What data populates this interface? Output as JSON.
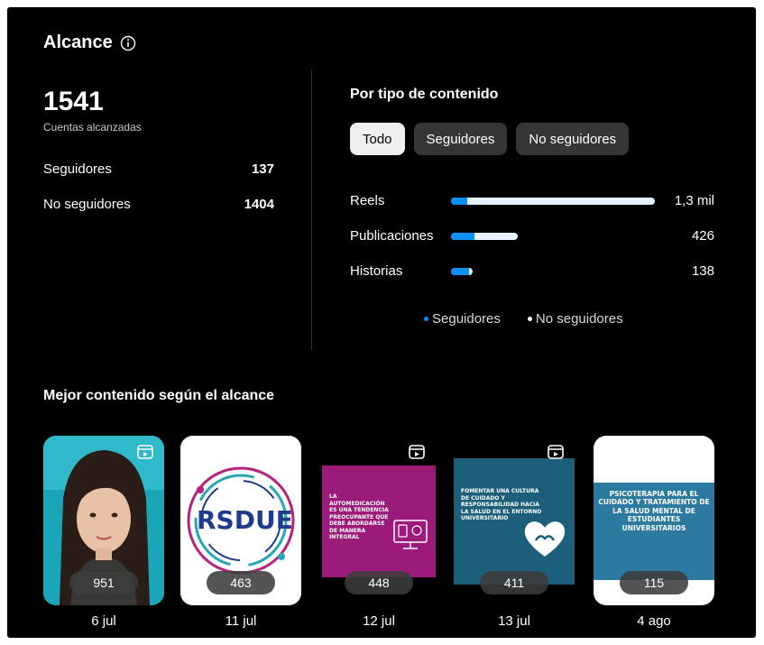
{
  "header": {
    "title": "Alcance",
    "info_icon": "info-circle-icon"
  },
  "summary": {
    "total": "1541",
    "total_label": "Cuentas alcanzadas",
    "rows": [
      {
        "label": "Seguidores",
        "value": "137"
      },
      {
        "label": "No seguidores",
        "value": "1404"
      }
    ]
  },
  "by_type": {
    "title": "Por tipo de contenido",
    "tabs": [
      {
        "label": "Todo",
        "active": true
      },
      {
        "label": "Seguidores",
        "active": false
      },
      {
        "label": "No seguidores",
        "active": false
      }
    ],
    "rows": [
      {
        "label": "Reels",
        "value": "1,3 mil",
        "total": 1300,
        "followers_fraction": 0.08
      },
      {
        "label": "Publicaciones",
        "value": "426",
        "total": 426,
        "followers_fraction": 0.35
      },
      {
        "label": "Historias",
        "value": "138",
        "total": 138,
        "followers_fraction": 0.85
      }
    ],
    "legend": [
      {
        "label": "Seguidores",
        "color": "#0a8ff5"
      },
      {
        "label": "No seguidores",
        "color": "#ffffff"
      }
    ]
  },
  "best_content": {
    "title": "Mejor contenido según el alcance",
    "items": [
      {
        "count": "951",
        "date": "6 jul",
        "icon": "reel-icon"
      },
      {
        "count": "463",
        "date": "11 jul",
        "thumb_text": "RSDUE"
      },
      {
        "count": "448",
        "date": "12 jul",
        "icon": "reel-icon",
        "thumb_text": "La automedicación es una tendencia preocupante que debe abordarse de manera integral"
      },
      {
        "count": "411",
        "date": "13 jul",
        "icon": "reel-icon",
        "thumb_text": "Fomentar una cultura de cuidado y responsabilidad hacia la salud en el entorno universitario"
      },
      {
        "count": "115",
        "date": "4 ago",
        "thumb_text": "Psicoterapia para el cuidado y tratamiento de la salud mental de estudiantes universitarios"
      }
    ]
  },
  "colors": {
    "background": "#000000",
    "accent": "#0a8ff5",
    "pill": "#363636",
    "pill_active": "#efefef"
  }
}
